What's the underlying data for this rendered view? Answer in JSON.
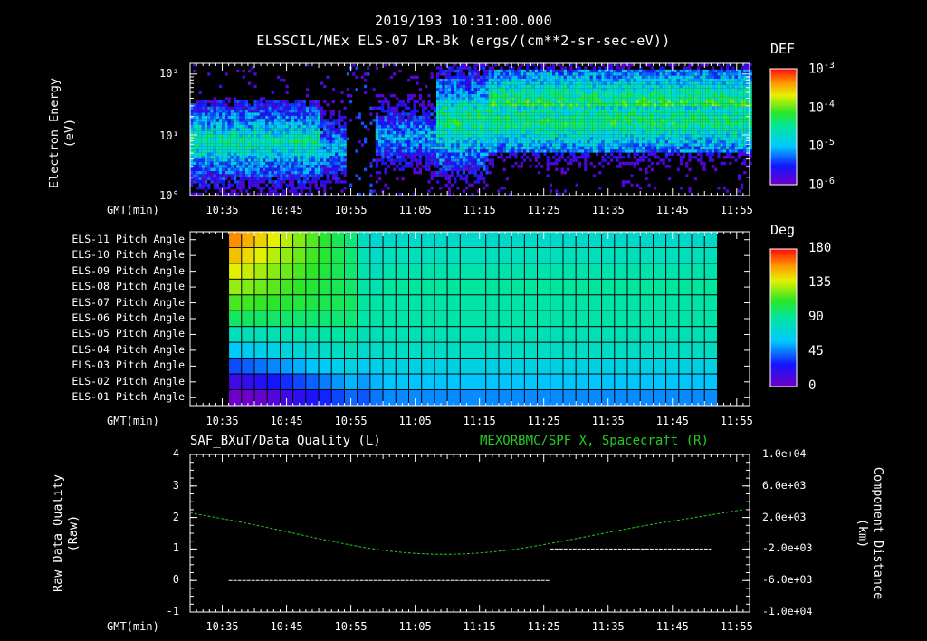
{
  "header": {
    "line1": "2019/193 10:31:00.000",
    "line2": "ELSSCIL/MEx ELS-07 LR-Bk  (ergs/(cm**2-sr-sec-eV))"
  },
  "colors": {
    "axes": "#ffffff",
    "series_left": "#ffffff",
    "series_right": "#22cc22",
    "right_title": "#22cc22"
  },
  "chart_data": [
    {
      "type": "heatmap",
      "panel": "top",
      "ylabel": [
        "Electron Energy",
        "(eV)"
      ],
      "xlabel": "GMT(min)",
      "y_scale": "log",
      "ylim": [
        1,
        150
      ],
      "y_ticks": [
        "10°",
        "10¹",
        "10²"
      ],
      "y_tick_values": [
        1,
        10,
        100
      ],
      "x_ticks": [
        "10:35",
        "10:45",
        "10:55",
        "11:05",
        "11:15",
        "11:25",
        "11:35",
        "11:45",
        "11:55"
      ],
      "colorbar": {
        "title": "DEF",
        "scale": "log",
        "range": [
          1e-06,
          0.001
        ],
        "labels": [
          {
            "base": "10",
            "exp": "-3"
          },
          {
            "base": "10",
            "exp": "-4"
          },
          {
            "base": "10",
            "exp": "-5"
          },
          {
            "base": "10",
            "exp": "-6"
          }
        ]
      }
    },
    {
      "type": "heatmap",
      "panel": "middle",
      "xlabel": "GMT(min)",
      "row_labels": [
        "ELS-11 Pitch Angle",
        "ELS-10 Pitch Angle",
        "ELS-09 Pitch Angle",
        "ELS-08 Pitch Angle",
        "ELS-07 Pitch Angle",
        "ELS-06 Pitch Angle",
        "ELS-05 Pitch Angle",
        "ELS-04 Pitch Angle",
        "ELS-03 Pitch Angle",
        "ELS-02 Pitch Angle",
        "ELS-01 Pitch Angle"
      ],
      "x_ticks": [
        "10:35",
        "10:45",
        "10:55",
        "11:05",
        "11:15",
        "11:25",
        "11:35",
        "11:45",
        "11:55"
      ],
      "data_start": "10:36",
      "data_end": "11:52",
      "columns": 38,
      "colorbar": {
        "title": "Deg",
        "range": [
          0,
          180
        ],
        "labels": [
          "180",
          "135",
          "90",
          "45",
          "0"
        ]
      }
    },
    {
      "type": "line",
      "panel": "bottom",
      "title_left": "SAF_BXuT/Data Quality (L)",
      "title_right": "MEXORBMC/SPF X, Spacecraft (R)",
      "xlabel": "GMT(min)",
      "ylabel_left": [
        "Raw Data Quality",
        "(Raw)"
      ],
      "ylabel_right": [
        "Component Distance",
        "(km)"
      ],
      "ylim_left": [
        -1,
        4
      ],
      "y_ticks_left": [
        "4",
        "3",
        "2",
        "1",
        "0",
        "-1"
      ],
      "ylim_right": [
        -10000,
        10000
      ],
      "y_ticks_right": [
        "1.0e+04",
        "6.0e+03",
        "2.0e+03",
        "-2.0e+03",
        "-6.0e+03",
        "-1.0e+04"
      ],
      "x_ticks": [
        "10:35",
        "10:45",
        "10:55",
        "11:05",
        "11:15",
        "11:25",
        "11:35",
        "11:45",
        "11:55"
      ],
      "series": [
        {
          "name": "SAF_BXuT/Data Quality",
          "axis": "left",
          "segments": [
            {
              "x_start": "10:36",
              "x_end": "11:26",
              "y": 0
            },
            {
              "x_start": "11:26",
              "x_end": "11:51",
              "y": 1
            }
          ]
        },
        {
          "name": "MEXORBMC/SPF X, Spacecraft",
          "axis": "right",
          "points": [
            {
              "x": "10:30",
              "y": 2600
            },
            {
              "x": "10:40",
              "y": 1100
            },
            {
              "x": "10:50",
              "y": -700
            },
            {
              "x": "11:00",
              "y": -2300
            },
            {
              "x": "11:10",
              "y": -2800
            },
            {
              "x": "11:20",
              "y": -2200
            },
            {
              "x": "11:30",
              "y": -700
            },
            {
              "x": "11:40",
              "y": 900
            },
            {
              "x": "11:50",
              "y": 2200
            },
            {
              "x": "11:56",
              "y": 3000
            }
          ]
        }
      ]
    }
  ]
}
